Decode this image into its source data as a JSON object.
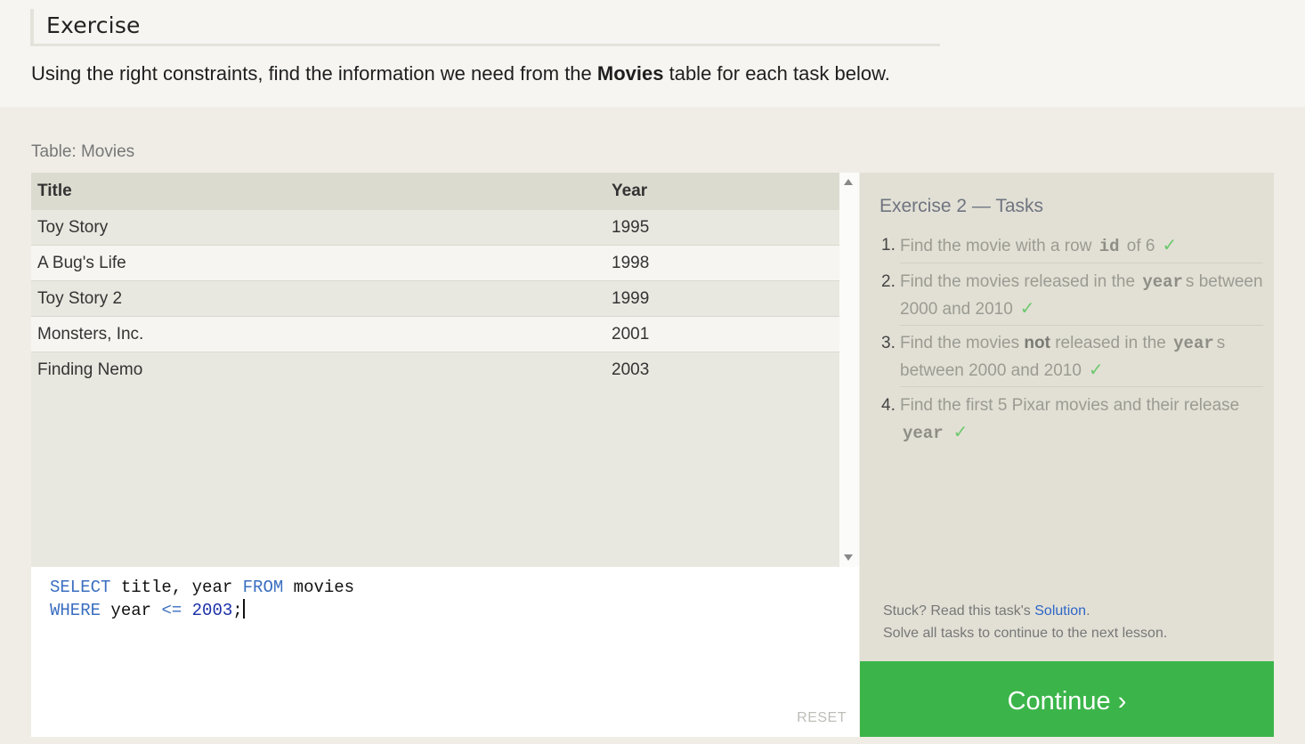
{
  "header": {
    "title": "Exercise",
    "intro_prefix": "Using the right constraints, find the information we need from the ",
    "intro_bold": "Movies",
    "intro_suffix": " table for each task below."
  },
  "table": {
    "label": "Table: Movies",
    "columns": [
      "Title",
      "Year"
    ],
    "rows": [
      {
        "title": "Toy Story",
        "year": "1995"
      },
      {
        "title": "A Bug's Life",
        "year": "1998"
      },
      {
        "title": "Toy Story 2",
        "year": "1999"
      },
      {
        "title": "Monsters, Inc.",
        "year": "2001"
      },
      {
        "title": "Finding Nemo",
        "year": "2003"
      }
    ]
  },
  "editor": {
    "line1": {
      "kw1": "SELECT",
      "text1": " title, year ",
      "kw2": "FROM",
      "text2": " movies"
    },
    "line2": {
      "kw1": "WHERE",
      "text1": " year ",
      "op": "<=",
      "space": " ",
      "num": "2003",
      "end": ";"
    },
    "reset_label": "RESET"
  },
  "tasks": {
    "title": "Exercise 2 — Tasks",
    "items": [
      {
        "num": "1.",
        "a": "Find the movie with a row ",
        "code": "id",
        "b": " of 6"
      },
      {
        "num": "2.",
        "a": "Find the movies released in the ",
        "code": "year",
        "b": "s between 2000 and 2010"
      },
      {
        "num": "3.",
        "a": "Find the movies ",
        "bold": "not",
        "a2": " released in the ",
        "code": "year",
        "b": "s between 2000 and 2010"
      },
      {
        "num": "4.",
        "a": "Find the first 5 Pixar movies and their release ",
        "code": "year",
        "b": ""
      }
    ],
    "check_glyph": "✓",
    "stuck_prefix": "Stuck? Read this task's ",
    "solution_link": "Solution",
    "stuck_suffix": ".",
    "solve_all": "Solve all tasks to continue to the next lesson."
  },
  "continue_label": "Continue ›",
  "colors": {
    "continue_bg": "#3bb54a",
    "check": "#6dc86d",
    "keyword": "#3a6ec0",
    "link": "#2e66c7"
  }
}
